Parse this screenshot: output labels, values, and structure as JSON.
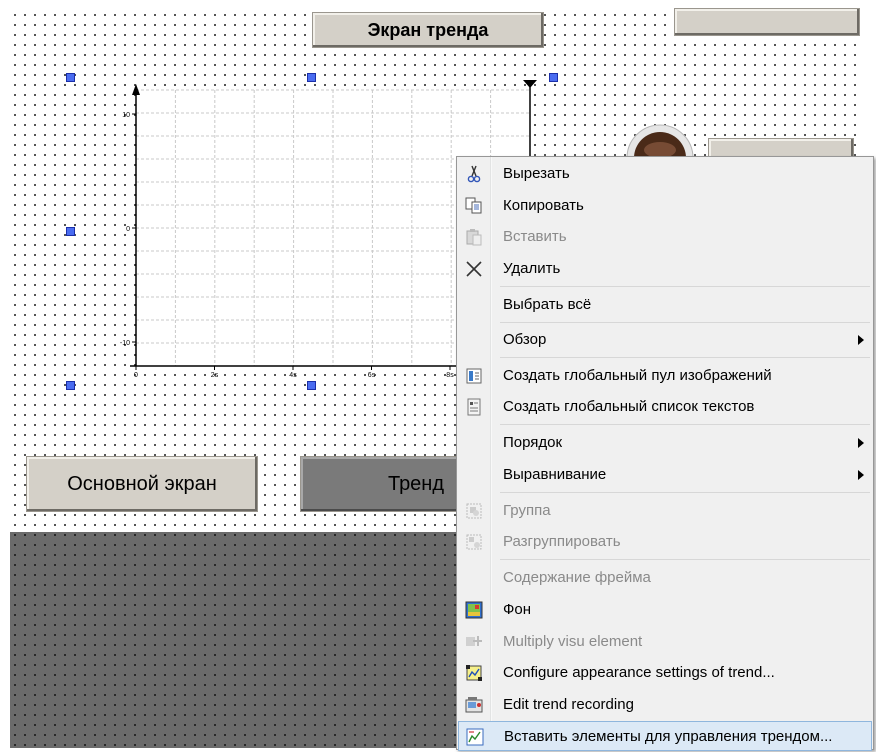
{
  "screen": {
    "title": "Экран тренда",
    "buttons": {
      "main": "Основной экран",
      "trend": "Тренд"
    }
  },
  "trend_chart": {
    "y_ticks": [
      "10",
      "0",
      "-10"
    ],
    "x_ticks": [
      "0",
      "2s",
      "4s",
      "6s",
      "8s"
    ]
  },
  "context_menu": {
    "items": [
      {
        "label": "Вырезать",
        "icon": "scissors-icon",
        "enabled": true
      },
      {
        "label": "Копировать",
        "icon": "copy-icon",
        "enabled": true
      },
      {
        "label": "Вставить",
        "icon": "paste-icon",
        "enabled": false
      },
      {
        "label": "Удалить",
        "icon": "delete-icon",
        "enabled": true
      },
      {
        "label": "Выбрать всё",
        "enabled": true
      },
      {
        "label": "Обзор",
        "enabled": true,
        "submenu": true
      },
      {
        "label": "Создать глобальный пул изображений",
        "icon": "image-pool-icon",
        "enabled": true
      },
      {
        "label": "Создать глобальный список текстов",
        "icon": "text-list-icon",
        "enabled": true
      },
      {
        "label": "Порядок",
        "enabled": true,
        "submenu": true
      },
      {
        "label": "Выравнивание",
        "enabled": true,
        "submenu": true
      },
      {
        "label": "Группа",
        "icon": "group-icon",
        "enabled": false
      },
      {
        "label": "Разгруппировать",
        "icon": "ungroup-icon",
        "enabled": false
      },
      {
        "label": "Содержание фрейма",
        "enabled": false
      },
      {
        "label": "Фон",
        "icon": "background-icon",
        "enabled": true
      },
      {
        "label": "Multiply visu element",
        "icon": "multiply-icon",
        "enabled": false
      },
      {
        "label": "Configure appearance settings of trend...",
        "icon": "trend-config-icon",
        "enabled": true
      },
      {
        "label": "Edit trend recording",
        "icon": "trend-record-icon",
        "enabled": true
      },
      {
        "label": "Вставить элементы для управления трендом...",
        "icon": "trend-insert-icon",
        "enabled": true,
        "highlighted": true
      }
    ]
  },
  "colors": {
    "selection_handle": "#4a6cf0",
    "menu_highlight": "#dce9f6",
    "editor_background": "#6b6b6b"
  }
}
